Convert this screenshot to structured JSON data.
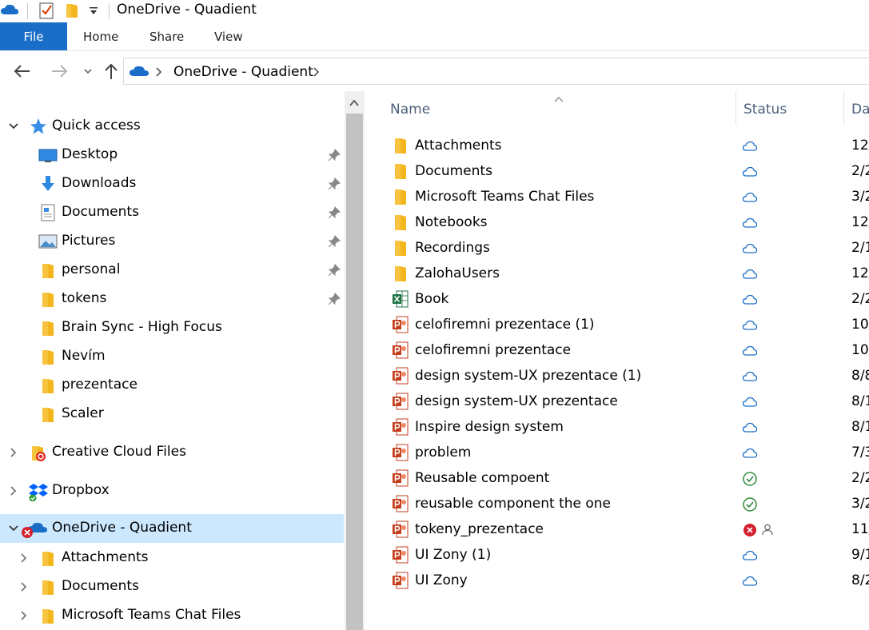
{
  "window": {
    "title": "OneDrive - Quadient"
  },
  "ribbon": {
    "tabs": [
      "File",
      "Home",
      "Share",
      "View"
    ]
  },
  "address_bar": {
    "crumb": "OneDrive - Quadient"
  },
  "nav_pane": {
    "quick_access": {
      "label": "Quick access",
      "items": [
        {
          "label": "Desktop",
          "icon": "desktop-icon",
          "pinned": true
        },
        {
          "label": "Downloads",
          "icon": "downloads-icon",
          "pinned": true
        },
        {
          "label": "Documents",
          "icon": "documents-icon",
          "pinned": true
        },
        {
          "label": "Pictures",
          "icon": "pictures-icon",
          "pinned": true
        },
        {
          "label": "personal",
          "icon": "folder-icon",
          "pinned": true
        },
        {
          "label": "tokens",
          "icon": "folder-icon",
          "pinned": true
        },
        {
          "label": "Brain Sync - High Focus",
          "icon": "folder-icon",
          "pinned": false
        },
        {
          "label": "Nevím",
          "icon": "folder-icon",
          "pinned": false
        },
        {
          "label": "prezentace",
          "icon": "folder-icon",
          "pinned": false
        },
        {
          "label": "Scaler",
          "icon": "folder-icon",
          "pinned": false
        }
      ]
    },
    "creative_cloud": {
      "label": "Creative Cloud Files"
    },
    "dropbox": {
      "label": "Dropbox"
    },
    "onedrive": {
      "label": "OneDrive - Quadient",
      "children": [
        {
          "label": "Attachments"
        },
        {
          "label": "Documents"
        },
        {
          "label": "Microsoft Teams Chat Files"
        }
      ]
    }
  },
  "file_list": {
    "columns": {
      "name": "Name",
      "status": "Status",
      "date": "Da"
    },
    "rows": [
      {
        "name": "Attachments",
        "type": "folder",
        "status": "cloud",
        "date": "12/"
      },
      {
        "name": "Documents",
        "type": "folder",
        "status": "cloud",
        "date": "2/2"
      },
      {
        "name": "Microsoft Teams Chat Files",
        "type": "folder",
        "status": "cloud",
        "date": "3/2"
      },
      {
        "name": "Notebooks",
        "type": "folder",
        "status": "cloud",
        "date": "12/"
      },
      {
        "name": "Recordings",
        "type": "folder",
        "status": "cloud",
        "date": "2/1"
      },
      {
        "name": "ZalohaUsers",
        "type": "folder",
        "status": "cloud",
        "date": "12/"
      },
      {
        "name": "Book",
        "type": "excel",
        "status": "cloud",
        "date": "2/2"
      },
      {
        "name": "celofiremni prezentace (1)",
        "type": "powerpoint",
        "status": "cloud",
        "date": "10/"
      },
      {
        "name": "celofiremni prezentace",
        "type": "powerpoint",
        "status": "cloud",
        "date": "10/"
      },
      {
        "name": "design system-UX prezentace (1)",
        "type": "powerpoint",
        "status": "cloud",
        "date": "8/8"
      },
      {
        "name": "design system-UX prezentace",
        "type": "powerpoint",
        "status": "cloud",
        "date": "8/1"
      },
      {
        "name": "Inspire design system",
        "type": "powerpoint",
        "status": "cloud",
        "date": "8/1"
      },
      {
        "name": "problem",
        "type": "powerpoint",
        "status": "cloud",
        "date": "7/3"
      },
      {
        "name": "Reusable compoent",
        "type": "powerpoint",
        "status": "synced",
        "date": "2/2"
      },
      {
        "name": "reusable component the one",
        "type": "powerpoint",
        "status": "synced",
        "date": "3/2"
      },
      {
        "name": "tokeny_prezentace",
        "type": "powerpoint",
        "status": "error-shared",
        "date": "11/"
      },
      {
        "name": "UI Zony (1)",
        "type": "powerpoint",
        "status": "cloud",
        "date": "9/1"
      },
      {
        "name": "UI Zony",
        "type": "powerpoint",
        "status": "cloud",
        "date": "8/2"
      }
    ]
  },
  "colors": {
    "accent": "#1a6ec7",
    "selection": "#cce8ff",
    "folder": "#f8c440",
    "cloud_status": "#1a6ec7",
    "synced": "#2f8a3a",
    "error": "#d4202e"
  }
}
